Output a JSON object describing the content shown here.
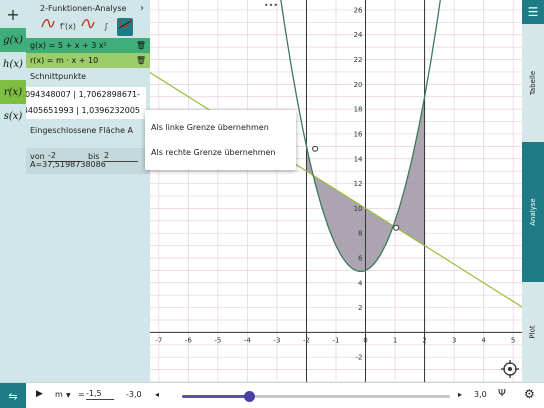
{
  "functions_rail": {
    "add_label": "+",
    "items": [
      {
        "label": "g(x)",
        "color": "#3fae7a"
      },
      {
        "label": "h(x)",
        "color": "#d0e6e8"
      },
      {
        "label": "r(x)",
        "color": "#7fbf3f"
      },
      {
        "label": "s(x)",
        "color": "#d0e6e8"
      }
    ]
  },
  "panel": {
    "title": "2-Funktionen-Analyse",
    "tools": {
      "derivative": "f'(x)",
      "integral": "∫"
    },
    "g_label": "g(x) = 5 + x + 3 x²",
    "r_label": "r(x) = m · x + 10",
    "intersections_label": "Schnittpunkte",
    "intersection_1": "-1,7062898671 | 14,8094348007",
    "intersection_2": "1,0396232005 | 8,4405651993",
    "area_label": "Eingeschlossene Fläche A",
    "from_label": "von",
    "from_value": "-2",
    "to_label": "bis",
    "to_value": "2",
    "result": "A=37,5198738086"
  },
  "context_menu": {
    "left_bound": "Als linke Grenze übernehmen",
    "right_bound": "Als rechte Grenze übernehmen"
  },
  "graph": {
    "more_label": "•••",
    "x_ticks": [
      "-7",
      "-6",
      "-5",
      "-4",
      "-3",
      "-2",
      "-1",
      "0",
      "1",
      "2",
      "3",
      "4",
      "5"
    ],
    "y_ticks": [
      "-2",
      "2",
      "4",
      "6",
      "8",
      "10",
      "12",
      "14",
      "16",
      "18",
      "20",
      "22",
      "24",
      "26"
    ],
    "colors": {
      "g": "#3d7a5a",
      "r": "#9bbd3c",
      "fill": "#a39ba8",
      "grid": "#e7cfe1"
    },
    "view": {
      "x_min": -7.3,
      "x_max": 5.3,
      "y_min": -4.0,
      "y_max": 26.8
    },
    "area_bounds": [
      -2,
      2
    ],
    "intersection_points": [
      [
        -1.7062898671,
        14.8094348007
      ],
      [
        1.0396232005,
        8.4405651993
      ]
    ]
  },
  "tabs": {
    "table": "Tabelle",
    "analysis": "Analyse",
    "plot": "Plot"
  },
  "slider": {
    "param": "m",
    "equals": "=",
    "value": "-1,5",
    "min_label": "-3,0",
    "max_label": "3,0",
    "min": -3.0,
    "max": 3.0,
    "current": -1.5
  }
}
